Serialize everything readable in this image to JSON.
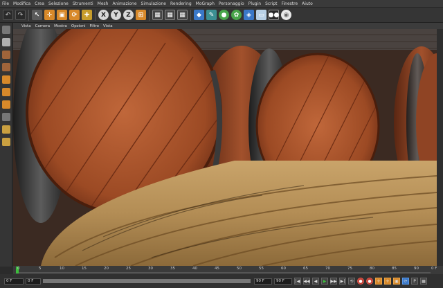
{
  "menu": [
    "File",
    "Modifica",
    "Crea",
    "Selezione",
    "Strumenti",
    "Mesh",
    "Animazione",
    "Simulazione",
    "Rendering",
    "MoGraph",
    "Personaggio",
    "Plugin",
    "Script",
    "Finestre",
    "Aiuto"
  ],
  "toolbar": {
    "axes": [
      "X",
      "Y",
      "Z"
    ],
    "icons": [
      "undo-icon",
      "redo-icon",
      "live-selection-icon",
      "move-icon",
      "scale-icon",
      "rotate-icon",
      "last-tool-icon",
      "x-axis-icon",
      "y-axis-icon",
      "z-axis-icon",
      "coordinate-system-icon",
      "render-view-icon",
      "render-picture-viewer-icon",
      "render-settings-icon",
      "cube-icon",
      "spline-pen-icon",
      "subdivision-icon",
      "array-icon",
      "deformer-icon",
      "floor-icon",
      "camera-icon",
      "light-icon"
    ]
  },
  "viewport_menu": [
    "Vista",
    "Camera",
    "Mostra",
    "Opzioni",
    "Filtro",
    "Vista"
  ],
  "timeline": {
    "ticks": [
      "0",
      "5",
      "10",
      "15",
      "20",
      "25",
      "30",
      "35",
      "40",
      "45",
      "50",
      "55",
      "60",
      "65",
      "70",
      "75",
      "80",
      "85",
      "90"
    ],
    "end_label": "0 F",
    "playhead_frame": 0
  },
  "transport": {
    "start_field": "0 F",
    "min_field": "0 F",
    "end_field": "90 F",
    "max_field": "90 F",
    "buttons": [
      "|◀",
      "◀◀",
      "◀",
      "▶",
      "▶▶",
      "▶|",
      "⟲"
    ]
  },
  "colors": {
    "accent_orange": "#d8892a",
    "play_green": "#3cbf3c",
    "record_red": "#c13a2f"
  }
}
